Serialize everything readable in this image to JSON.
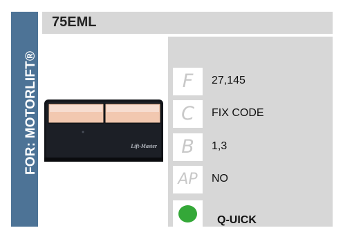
{
  "sidebar": {
    "label": "FOR: MOTORLIFT®"
  },
  "header": {
    "title": "75EML"
  },
  "remote": {
    "brand": "Lift-Master"
  },
  "specs": [
    {
      "letter": "F",
      "value": "27,145"
    },
    {
      "letter": "C",
      "value": "FIX CODE"
    },
    {
      "letter": "B",
      "value": "1,3"
    },
    {
      "letter": "AP",
      "value": "NO"
    }
  ],
  "quick": {
    "label": "Q-UICK",
    "color": "#34a838"
  },
  "colors": {
    "sidebar": "#4d7396",
    "panel": "#d7d7d7"
  }
}
